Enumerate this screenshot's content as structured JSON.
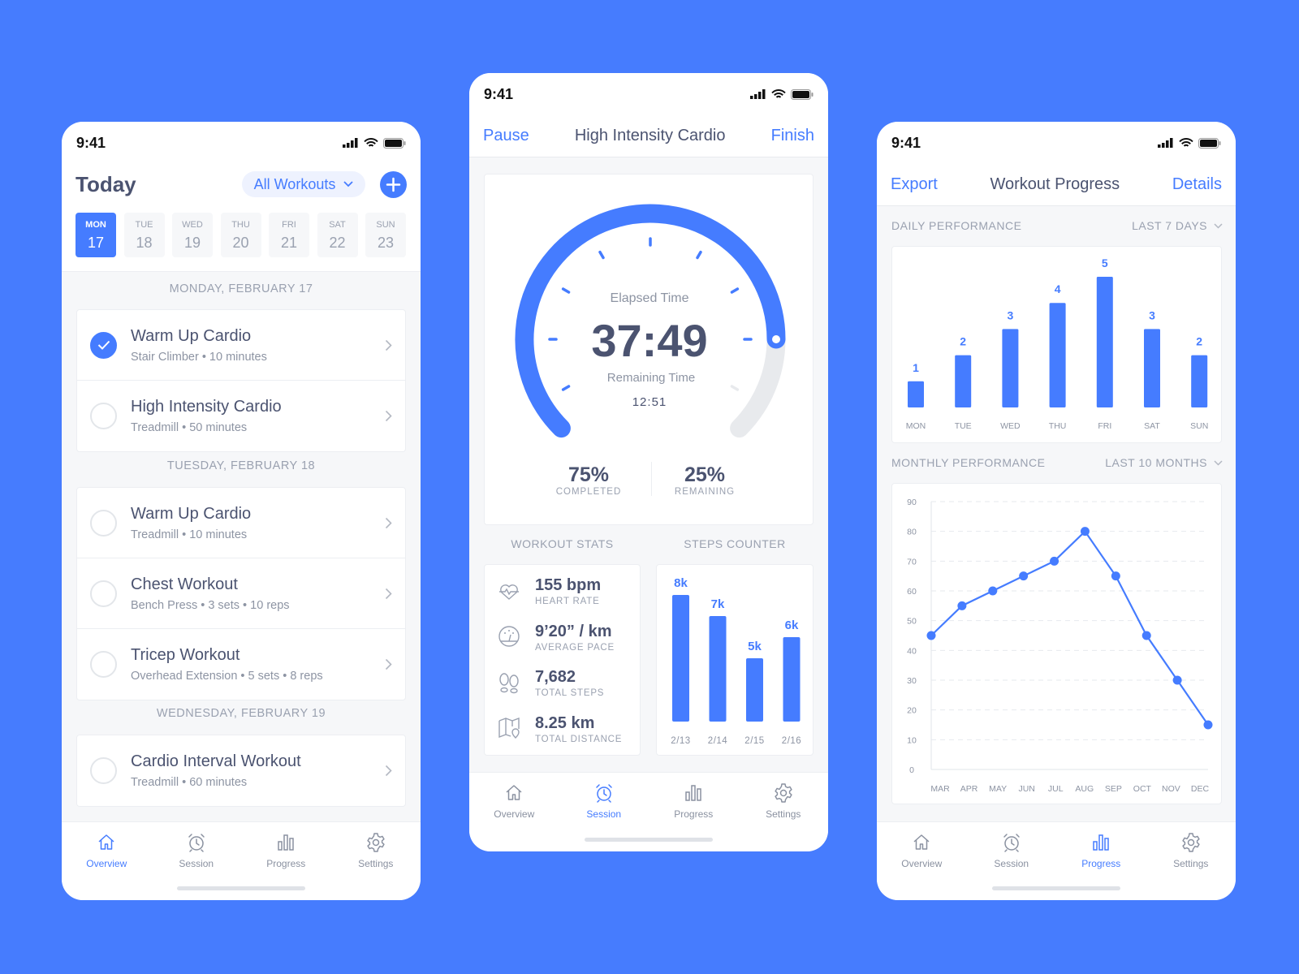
{
  "colors": {
    "accent": "#457cff",
    "background": "#467cfe",
    "text": "#4b5370",
    "muted": "#9aa1b0",
    "track": "#e8eaed"
  },
  "status_time": "9:41",
  "tabs": [
    {
      "label": "Overview",
      "icon": "home-icon"
    },
    {
      "label": "Session",
      "icon": "alarm-clock-icon"
    },
    {
      "label": "Progress",
      "icon": "bar-chart-icon"
    },
    {
      "label": "Settings",
      "icon": "gear-icon"
    }
  ],
  "overview": {
    "title": "Today",
    "filter": "All Workouts",
    "active_tab": "Overview",
    "days": [
      {
        "name": "MON",
        "date": "17",
        "selected": true
      },
      {
        "name": "TUE",
        "date": "18"
      },
      {
        "name": "WED",
        "date": "19"
      },
      {
        "name": "THU",
        "date": "20"
      },
      {
        "name": "FRI",
        "date": "21"
      },
      {
        "name": "SAT",
        "date": "22"
      },
      {
        "name": "SUN",
        "date": "23"
      }
    ],
    "sections": [
      {
        "label": "MONDAY, FEBRUARY 17",
        "items": [
          {
            "title": "Warm Up Cardio",
            "subtitle": "Stair Climber • 10 minutes",
            "done": true
          },
          {
            "title": "High Intensity Cardio",
            "subtitle": "Treadmill • 50 minutes",
            "done": false
          }
        ]
      },
      {
        "label": "TUESDAY, FEBRUARY 18",
        "items": [
          {
            "title": "Warm Up Cardio",
            "subtitle": "Treadmill • 10 minutes",
            "done": false
          },
          {
            "title": "Chest Workout",
            "subtitle": "Bench Press • 3 sets • 10 reps",
            "done": false
          },
          {
            "title": "Tricep Workout",
            "subtitle": "Overhead Extension • 5 sets • 8 reps",
            "done": false
          }
        ]
      },
      {
        "label": "WEDNESDAY, FEBRUARY 19",
        "items": [
          {
            "title": "Cardio Interval Workout",
            "subtitle": "Treadmill • 60 minutes",
            "done": false
          }
        ]
      }
    ]
  },
  "session": {
    "left": "Pause",
    "title": "High Intensity Cardio",
    "right": "Finish",
    "active_tab": "Session",
    "elapsed_label": "Elapsed Time",
    "elapsed": "37:49",
    "remaining_label": "Remaining Time",
    "remaining": "12:51",
    "completed_pct": "75%",
    "completed_label": "COMPLETED",
    "completed_fraction": 0.75,
    "remaining_pct": "25%",
    "remaining_pct_label": "REMAINING",
    "stats_label": "WORKOUT STATS",
    "steps_label": "STEPS COUNTER",
    "stats": [
      {
        "value": "155 bpm",
        "label": "HEART RATE",
        "icon": "heart-rate-icon"
      },
      {
        "value": "9’20” / km",
        "label": "AVERAGE PACE",
        "icon": "speedometer-icon"
      },
      {
        "value": "7,682",
        "label": "TOTAL STEPS",
        "icon": "footsteps-icon"
      },
      {
        "value": "8.25 km",
        "label": "TOTAL DISTANCE",
        "icon": "map-pin-icon"
      }
    ]
  },
  "progress": {
    "left": "Export",
    "title": "Workout Progress",
    "right": "Details",
    "active_tab": "Progress",
    "daily_label": "DAILY PERFORMANCE",
    "daily_range": "LAST 7 DAYS",
    "monthly_label": "MONTHLY PERFORMANCE",
    "monthly_range": "LAST 10 MONTHS"
  },
  "chart_data": [
    {
      "type": "bar",
      "categories": [
        "2/13",
        "2/14",
        "2/15",
        "2/16"
      ],
      "values": [
        8,
        7,
        5,
        6
      ],
      "labels": [
        "8k",
        "7k",
        "5k",
        "6k"
      ]
    },
    {
      "type": "bar",
      "categories": [
        "MON",
        "TUE",
        "WED",
        "THU",
        "FRI",
        "SAT",
        "SUN"
      ],
      "values": [
        1,
        2,
        3,
        4,
        5,
        3,
        2
      ],
      "ylim": [
        0,
        5
      ]
    },
    {
      "type": "line",
      "categories": [
        "MAR",
        "APR",
        "MAY",
        "JUN",
        "JUL",
        "AUG",
        "SEP",
        "OCT",
        "NOV",
        "DEC"
      ],
      "values": [
        45,
        55,
        60,
        65,
        70,
        80,
        65,
        45,
        30,
        15
      ],
      "ylim": [
        0,
        90
      ],
      "yticks": [
        0,
        10,
        20,
        30,
        40,
        50,
        60,
        70,
        80,
        90
      ],
      "grid": true
    }
  ]
}
